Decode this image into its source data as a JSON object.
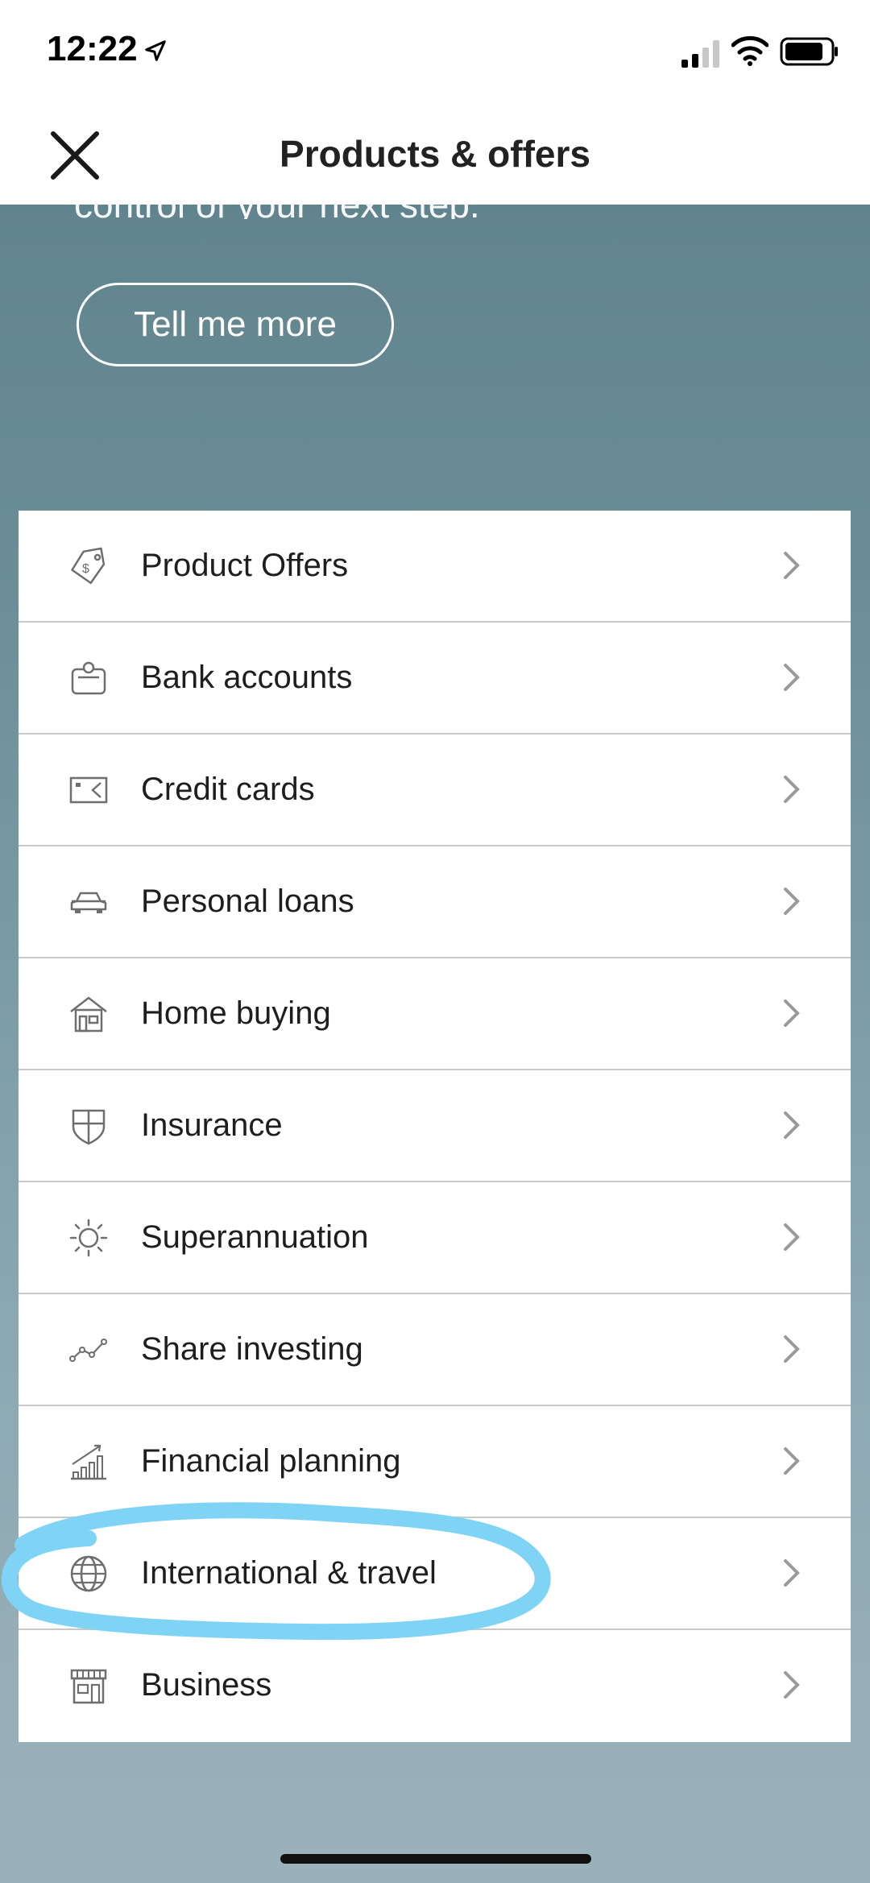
{
  "status_bar": {
    "time": "12:22"
  },
  "nav": {
    "title": "Products & offers"
  },
  "hero": {
    "text_clipped": "control of your next step.",
    "cta_label": "Tell me more"
  },
  "menu": {
    "items": [
      {
        "label": "Product Offers",
        "icon": "price-tag-icon"
      },
      {
        "label": "Bank accounts",
        "icon": "piggy-bank-icon"
      },
      {
        "label": "Credit cards",
        "icon": "credit-card-icon"
      },
      {
        "label": "Personal loans",
        "icon": "car-icon"
      },
      {
        "label": "Home buying",
        "icon": "house-icon"
      },
      {
        "label": "Insurance",
        "icon": "shield-icon"
      },
      {
        "label": "Superannuation",
        "icon": "sun-icon"
      },
      {
        "label": "Share investing",
        "icon": "line-trend-icon"
      },
      {
        "label": "Financial planning",
        "icon": "bar-growth-icon"
      },
      {
        "label": "International & travel",
        "icon": "globe-icon"
      },
      {
        "label": "Business",
        "icon": "storefront-icon"
      }
    ]
  },
  "colors": {
    "annotation": "#7fd3f5",
    "icon": "#6e6e6e",
    "chevron": "#9a9a9a"
  }
}
